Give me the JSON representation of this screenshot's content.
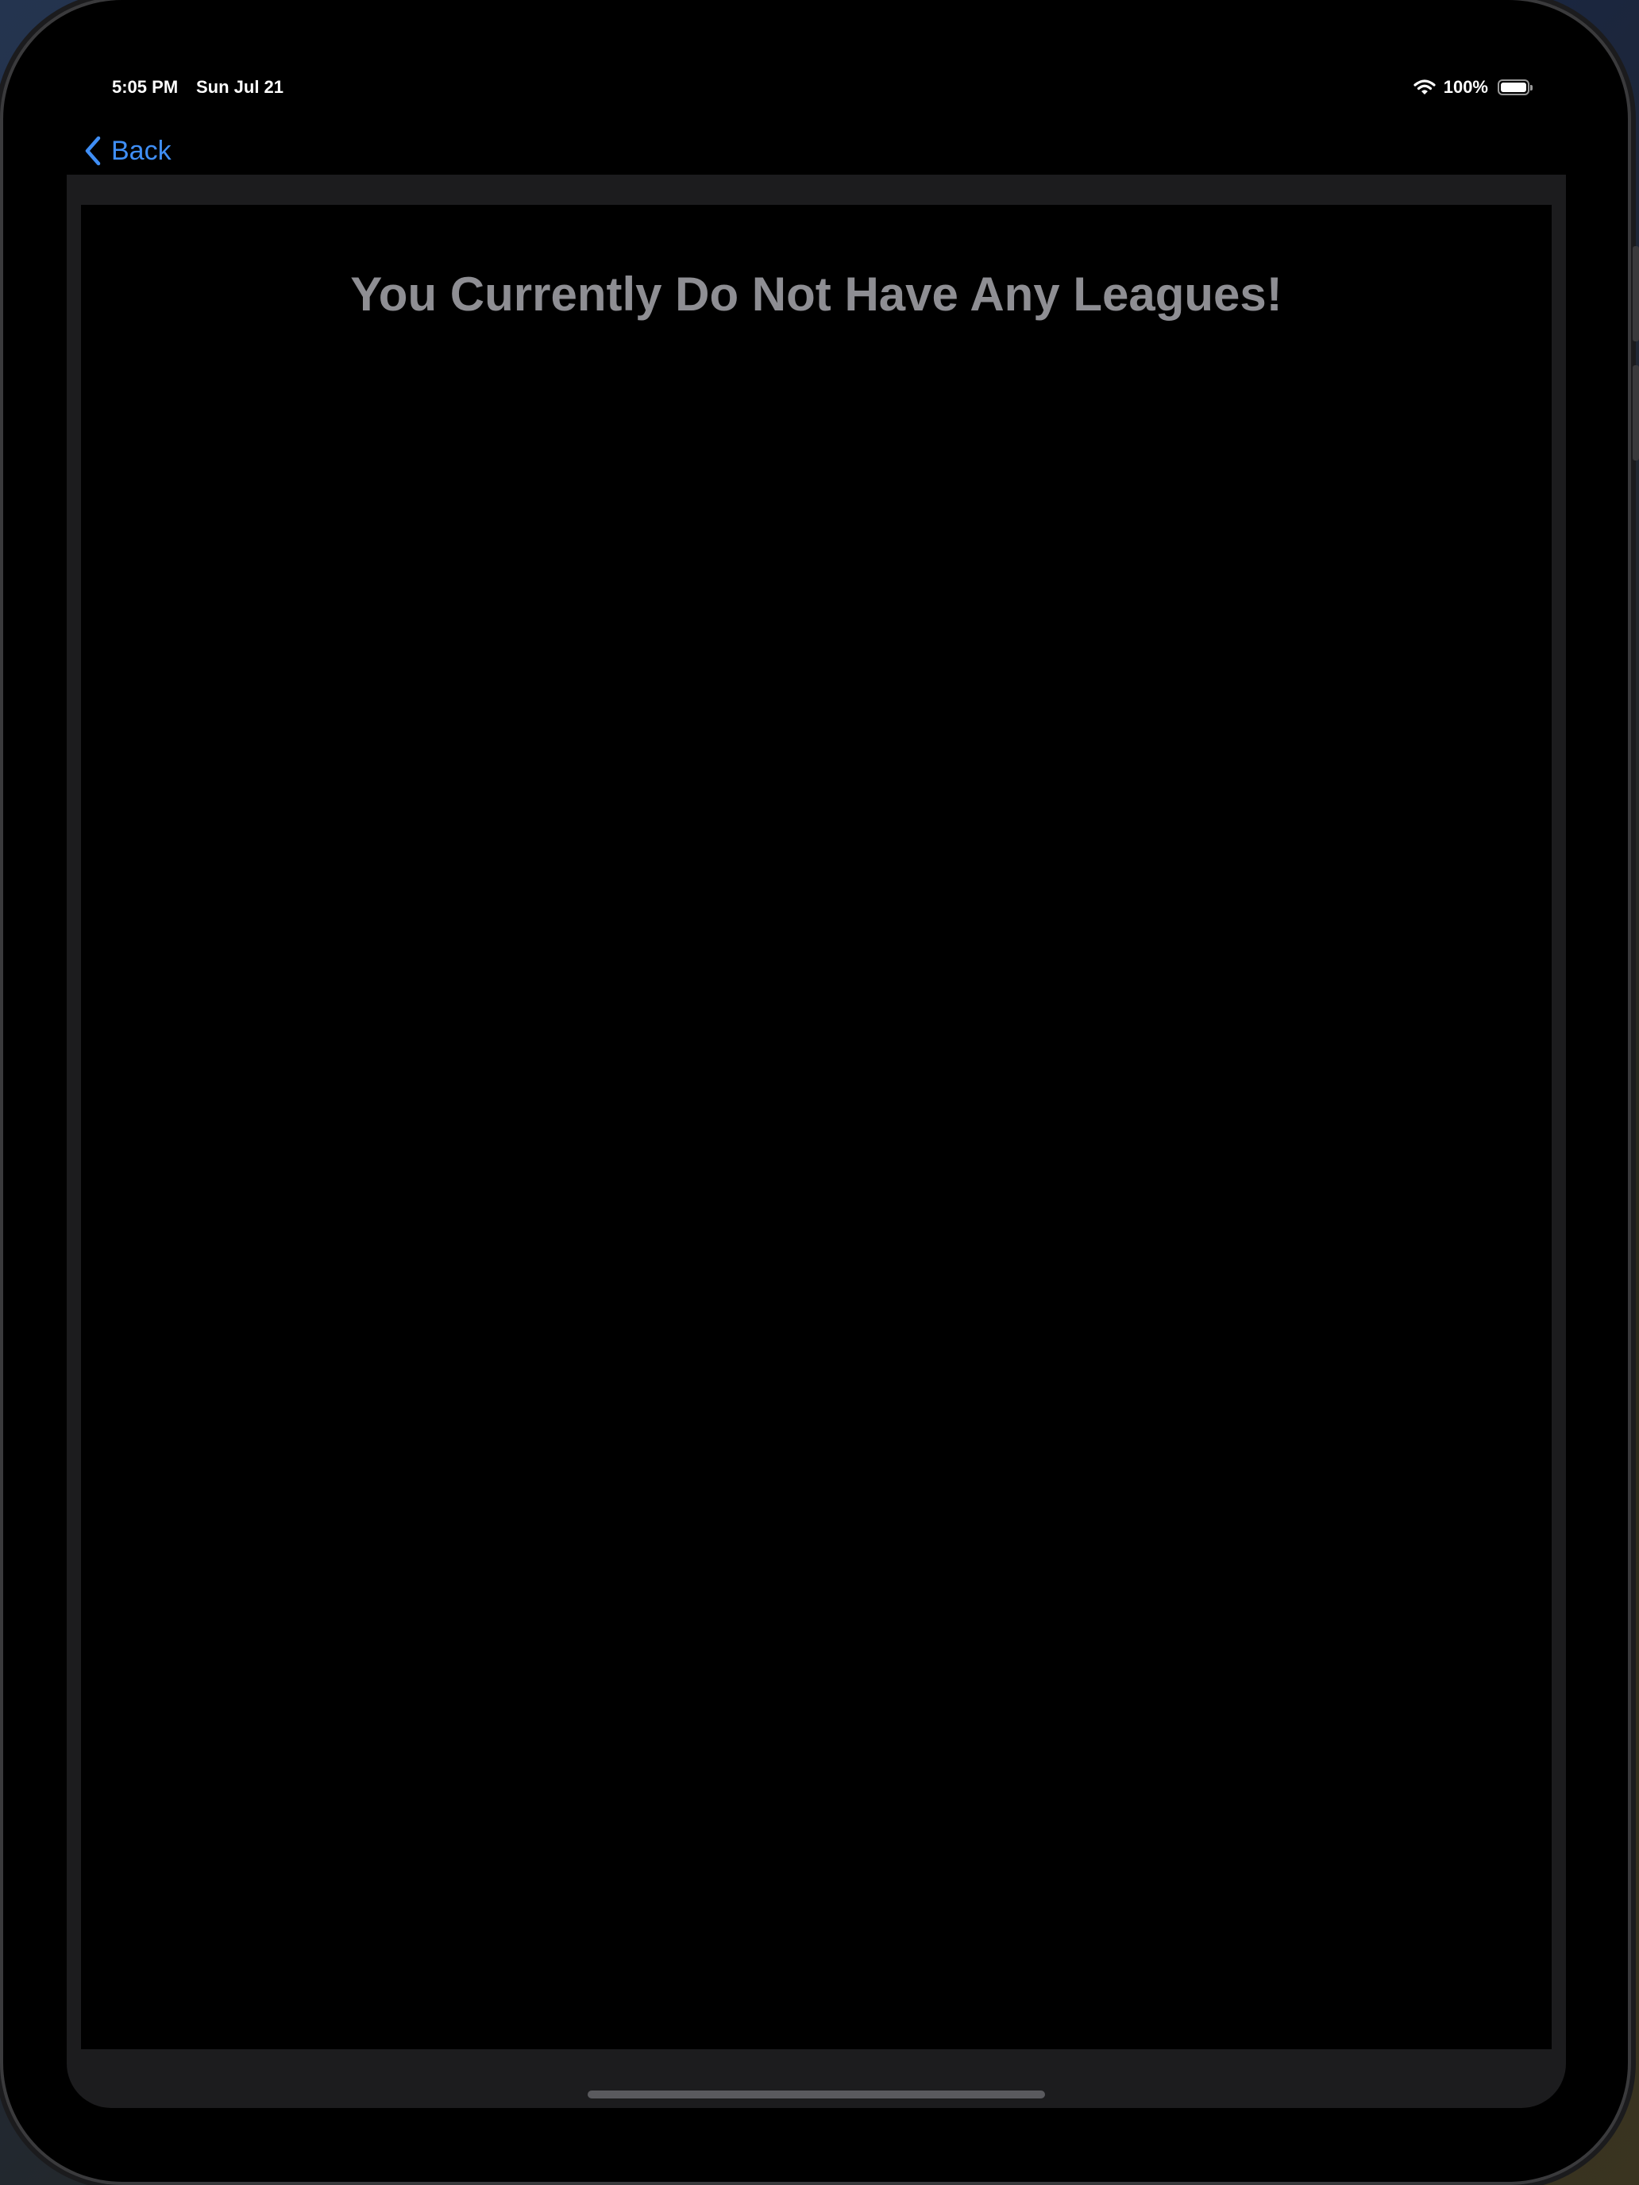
{
  "status_bar": {
    "time": "5:05 PM",
    "date": "Sun Jul 21",
    "battery_percent": "100%",
    "battery_level": 1.0,
    "wifi_icon": "wifi-icon",
    "battery_icon": "battery-icon"
  },
  "nav": {
    "back_label": "Back",
    "back_icon": "chevron-left-icon"
  },
  "main": {
    "empty_message": "You Currently Do Not Have Any Leagues!"
  },
  "colors": {
    "accent": "#3f8ef5",
    "background": "#000000",
    "card": "#1c1c1e",
    "message_text": "#8e8e93"
  }
}
